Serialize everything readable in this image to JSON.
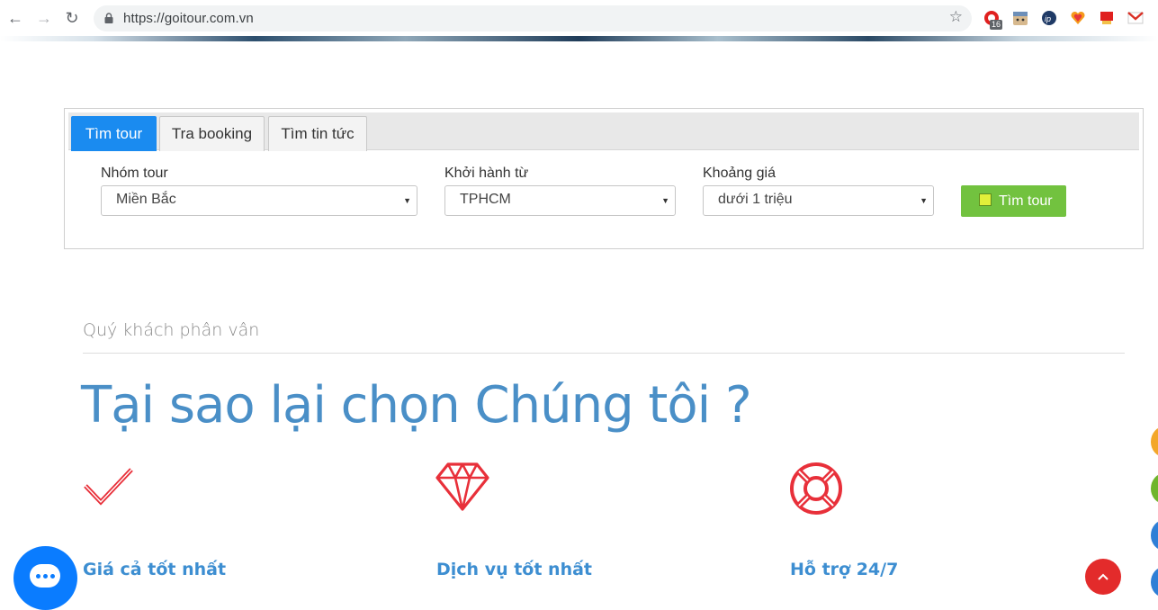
{
  "browser": {
    "url": "https://goitour.com.vn",
    "extension_badge": "16"
  },
  "search": {
    "tabs": [
      {
        "label": "Tìm tour",
        "active": true
      },
      {
        "label": "Tra booking",
        "active": false
      },
      {
        "label": "Tìm tin tức",
        "active": false
      }
    ],
    "fields": [
      {
        "label": "Nhóm tour",
        "value": "Miền Bắc"
      },
      {
        "label": "Khởi hành từ",
        "value": "TPHCM"
      },
      {
        "label": "Khoảng giá",
        "value": "dưới 1 triệu"
      }
    ],
    "button_label": "Tìm tour",
    "accent": "#1a8bf0",
    "button_color": "#72c23f"
  },
  "why": {
    "subtitle": "Quý khách phân vân",
    "headline": "Tại sao lại chọn Chúng tôi ?",
    "features": [
      {
        "icon": "checkmark-icon",
        "title": "Giá cả tốt nhất"
      },
      {
        "icon": "diamond-icon",
        "title": "Dịch vụ tốt nhất"
      },
      {
        "icon": "lifebuoy-icon",
        "title": "Hỗ trợ 24/7"
      }
    ],
    "icon_color": "#e8303a",
    "headline_color": "#4a8fc7"
  }
}
